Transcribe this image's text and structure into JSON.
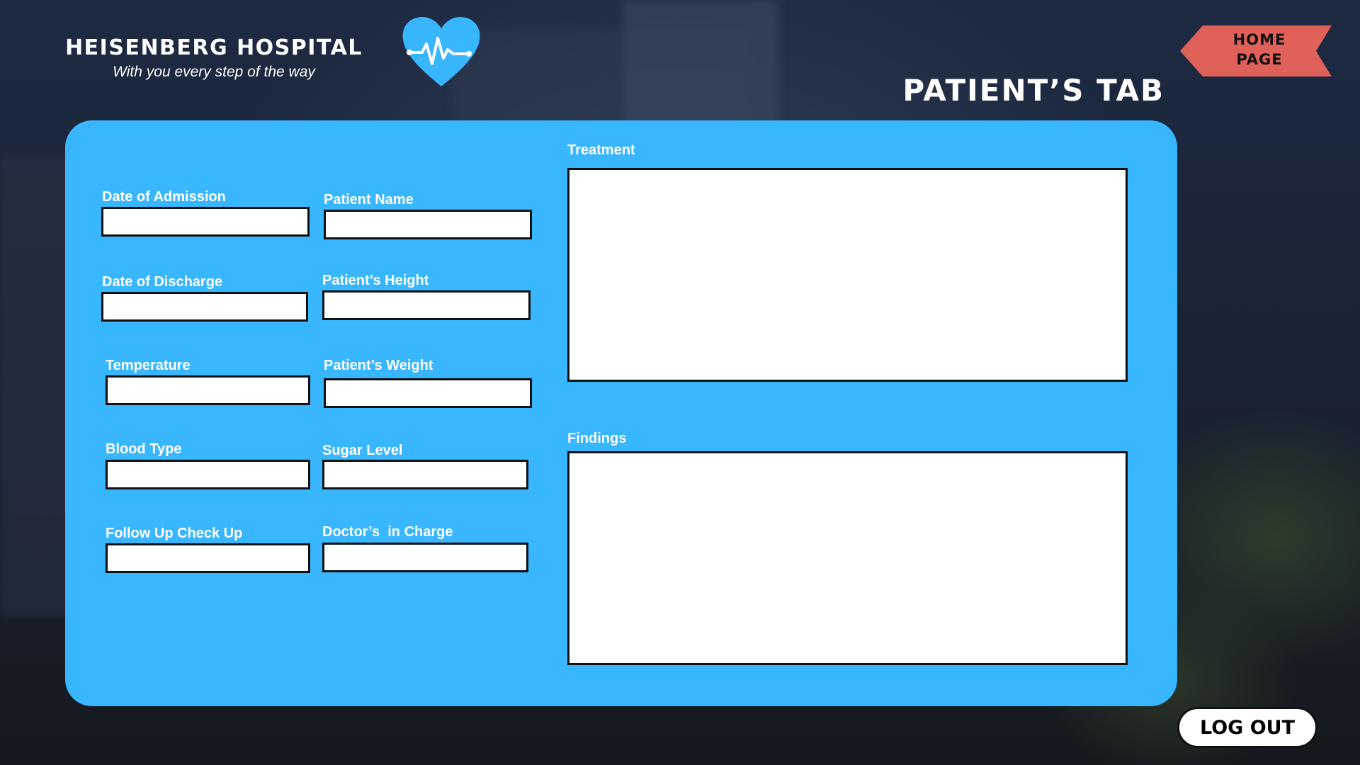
{
  "header": {
    "brand_name": "HEISENBERG HOSPITAL",
    "tagline": "With you every step of the way",
    "logo_icon": "heart-pulse-icon",
    "page_title": "PATIENT’S TAB",
    "home_button": {
      "line1": "HOME",
      "line2": "PAGE"
    }
  },
  "form": {
    "date_of_admission": {
      "label": "Date of Admission",
      "value": ""
    },
    "patient_name": {
      "label": "Patient Name",
      "value": ""
    },
    "date_of_discharge": {
      "label": "Date of Discharge",
      "value": ""
    },
    "patient_height": {
      "label": "Patient’s Height",
      "value": ""
    },
    "temperature": {
      "label": "Temperature",
      "value": ""
    },
    "patient_weight": {
      "label": "Patient’s Weight",
      "value": ""
    },
    "blood_type": {
      "label": "Blood Type",
      "value": ""
    },
    "sugar_level": {
      "label": "Sugar Level",
      "value": ""
    },
    "follow_up": {
      "label": "Follow Up Check Up",
      "value": ""
    },
    "doctor_in_charge": {
      "label": "Doctor’s  in Charge",
      "value": ""
    },
    "treatment": {
      "label": "Treatment",
      "value": ""
    },
    "findings": {
      "label": "Findings",
      "value": ""
    }
  },
  "footer": {
    "logout_label": "LOG OUT"
  },
  "colors": {
    "panel": "#38b6ff",
    "logo": "#38b6ff",
    "home_button": "#e0605a",
    "background": "#1a2130"
  }
}
